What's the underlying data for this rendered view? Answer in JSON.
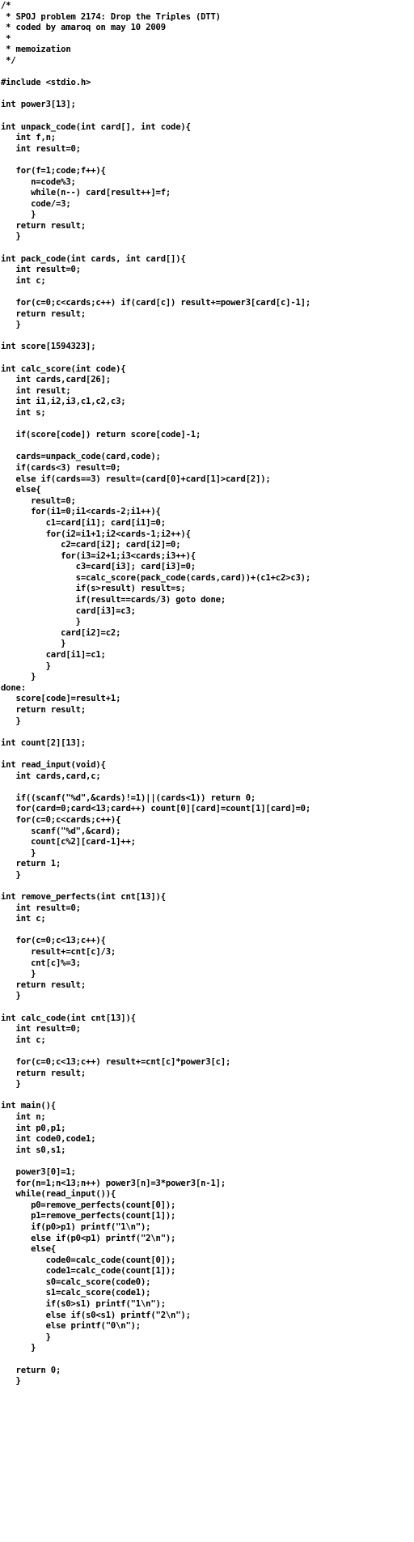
{
  "document": {
    "lines": [
      "/*",
      " * SPOJ problem 2174: Drop the Triples (DTT)",
      " * coded by amaroq on may 10 2009",
      " *",
      " * memoization",
      " */",
      "",
      "#include <stdio.h>",
      "",
      "int power3[13];",
      "",
      "int unpack_code(int card[], int code){",
      "   int f,n;",
      "   int result=0;",
      "",
      "   for(f=1;code;f++){",
      "      n=code%3;",
      "      while(n--) card[result++]=f;",
      "      code/=3;",
      "      }",
      "   return result;",
      "   }",
      "",
      "int pack_code(int cards, int card[]){",
      "   int result=0;",
      "   int c;",
      "",
      "   for(c=0;c<cards;c++) if(card[c]) result+=power3[card[c]-1];",
      "   return result;",
      "   }",
      "",
      "int score[1594323];",
      "",
      "int calc_score(int code){",
      "   int cards,card[26];",
      "   int result;",
      "   int i1,i2,i3,c1,c2,c3;",
      "   int s;",
      "",
      "   if(score[code]) return score[code]-1;",
      "",
      "   cards=unpack_code(card,code);",
      "   if(cards<3) result=0;",
      "   else if(cards==3) result=(card[0]+card[1]>card[2]);",
      "   else{",
      "      result=0;",
      "      for(i1=0;i1<cards-2;i1++){",
      "         c1=card[i1]; card[i1]=0;",
      "         for(i2=i1+1;i2<cards-1;i2++){",
      "            c2=card[i2]; card[i2]=0;",
      "            for(i3=i2+1;i3<cards;i3++){",
      "               c3=card[i3]; card[i3]=0;",
      "               s=calc_score(pack_code(cards,card))+(c1+c2>c3);",
      "               if(s>result) result=s;",
      "               if(result==cards/3) goto done;",
      "               card[i3]=c3;",
      "               }",
      "            card[i2]=c2;",
      "            }",
      "         card[i1]=c1;",
      "         }",
      "      }",
      "done:",
      "   score[code]=result+1;",
      "   return result;",
      "   }",
      "",
      "int count[2][13];",
      "",
      "int read_input(void){",
      "   int cards,card,c;",
      "",
      "   if((scanf(\"%d\",&cards)!=1)||(cards<1)) return 0;",
      "   for(card=0;card<13;card++) count[0][card]=count[1][card]=0;",
      "   for(c=0;c<cards;c++){",
      "      scanf(\"%d\",&card);",
      "      count[c%2][card-1]++;",
      "      }",
      "   return 1;",
      "   }",
      "",
      "int remove_perfects(int cnt[13]){",
      "   int result=0;",
      "   int c;",
      "",
      "   for(c=0;c<13;c++){",
      "      result+=cnt[c]/3;",
      "      cnt[c]%=3;",
      "      }",
      "   return result;",
      "   }",
      "",
      "int calc_code(int cnt[13]){",
      "   int result=0;",
      "   int c;",
      "",
      "   for(c=0;c<13;c++) result+=cnt[c]*power3[c];",
      "   return result;",
      "   }",
      "",
      "int main(){",
      "   int n;",
      "   int p0,p1;",
      "   int code0,code1;",
      "   int s0,s1;",
      "",
      "   power3[0]=1;",
      "   for(n=1;n<13;n++) power3[n]=3*power3[n-1];",
      "   while(read_input()){",
      "      p0=remove_perfects(count[0]);",
      "      p1=remove_perfects(count[1]);",
      "      if(p0>p1) printf(\"1\\n\");",
      "      else if(p0<p1) printf(\"2\\n\");",
      "      else{",
      "         code0=calc_code(count[0]);",
      "         code1=calc_code(count[1]);",
      "         s0=calc_score(code0);",
      "         s1=calc_score(code1);",
      "         if(s0>s1) printf(\"1\\n\");",
      "         else if(s0<s1) printf(\"2\\n\");",
      "         else printf(\"0\\n\");",
      "         }",
      "      }",
      "",
      "   return 0;",
      "   }"
    ]
  }
}
